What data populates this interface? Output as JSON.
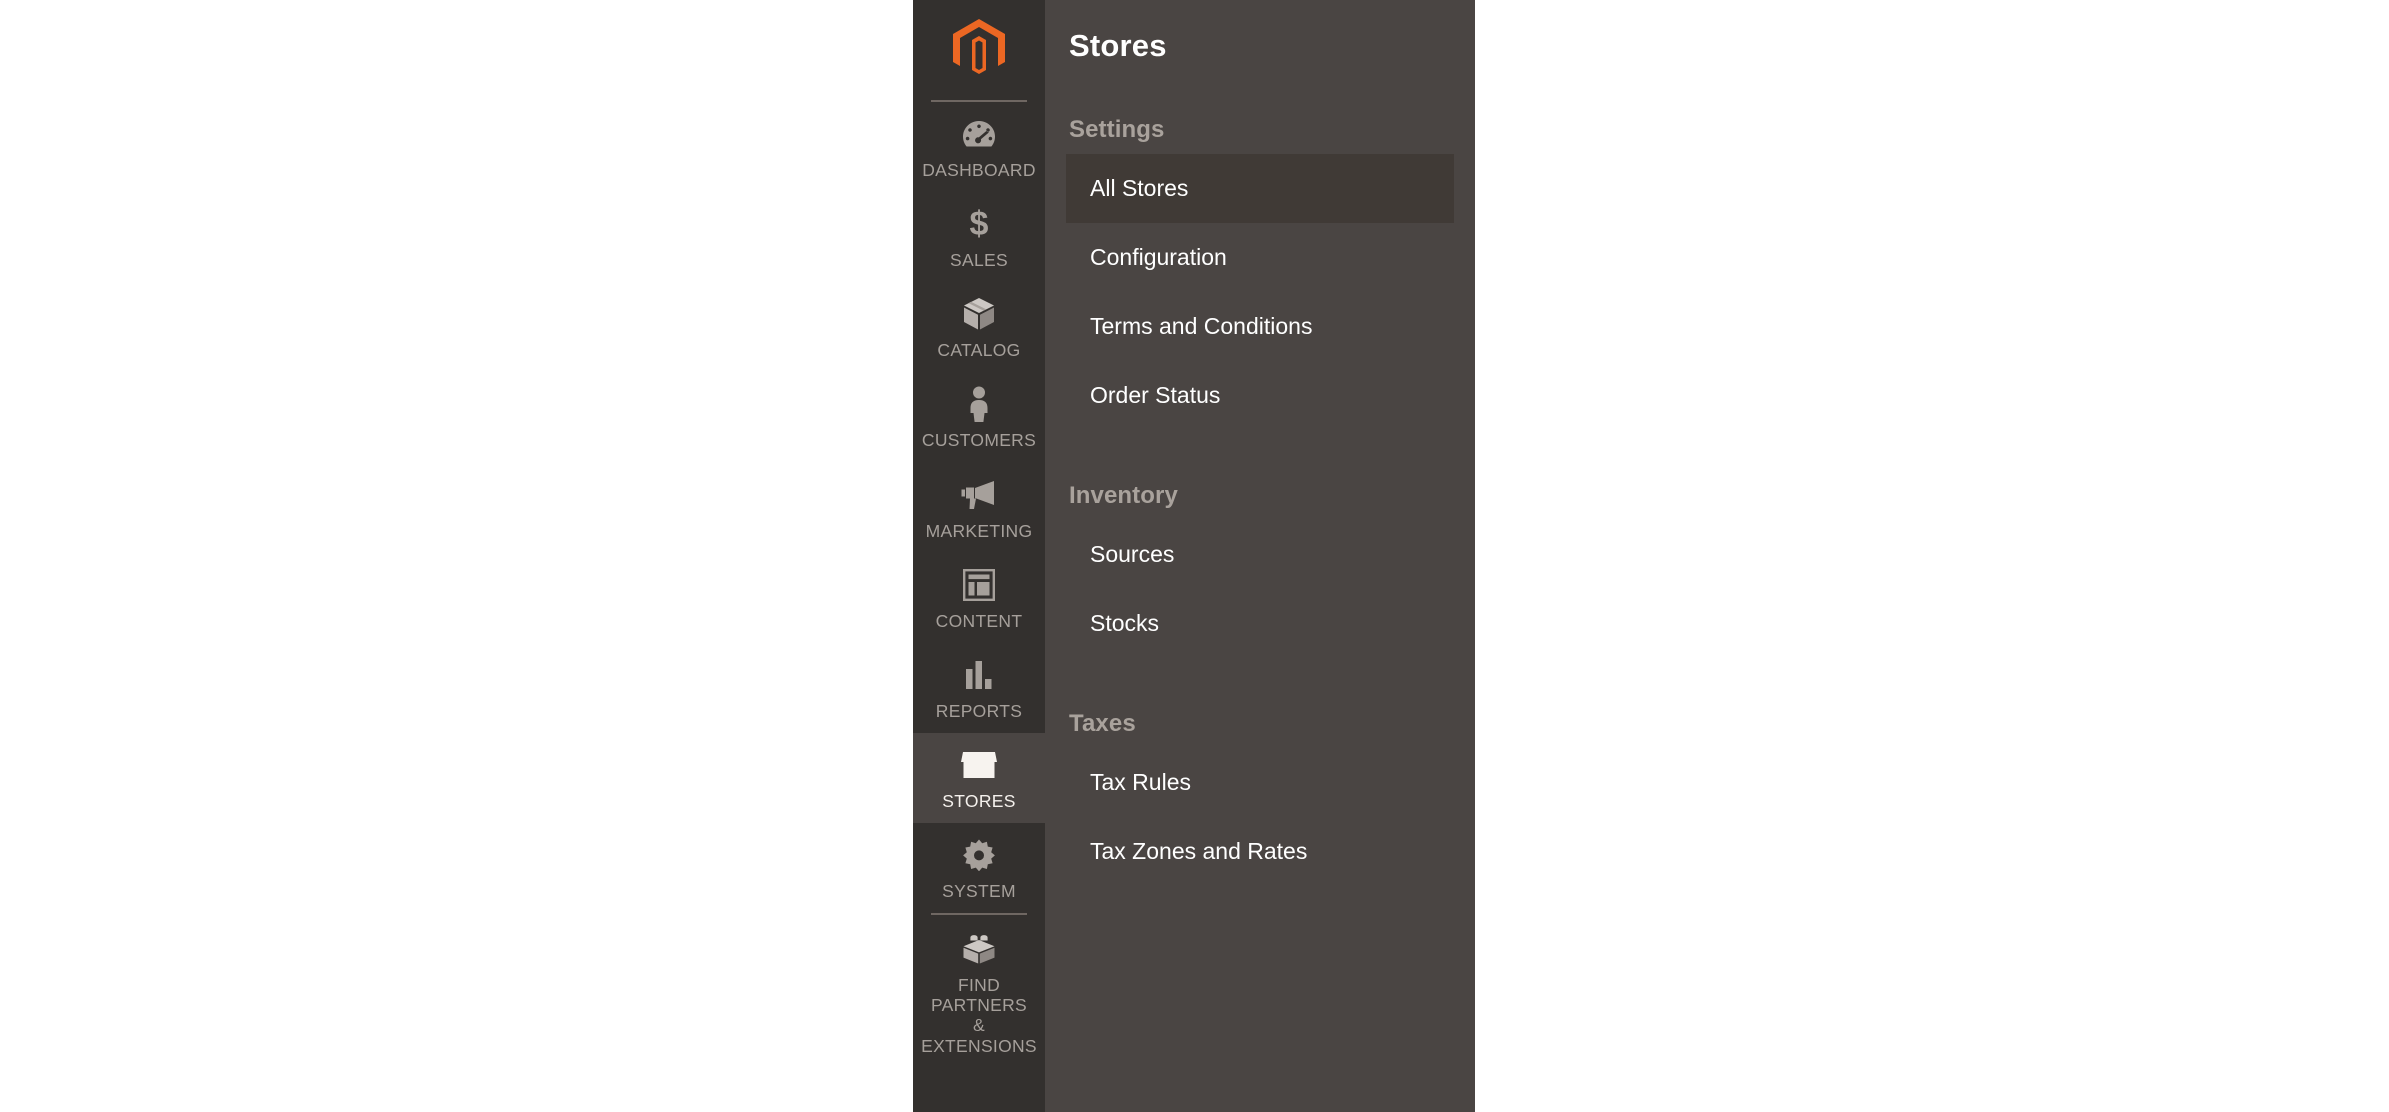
{
  "brand": {
    "logo_icon": "magento-logo-icon",
    "logo_color": "#ec6723"
  },
  "colors": {
    "rail_background": "#33302e",
    "submenu_background": "#4a4543",
    "active_item_background": "#403a36",
    "active_rail_background": "#4a4543",
    "label_text": "#a6a09b",
    "submenu_text": "#ffffff",
    "group_heading_text": "#a9a29c"
  },
  "rail": {
    "items": [
      {
        "label": "DASHBOARD",
        "icon": "gauge-icon",
        "active": false
      },
      {
        "label": "SALES",
        "icon": "dollar-icon",
        "active": false
      },
      {
        "label": "CATALOG",
        "icon": "box-icon",
        "active": false
      },
      {
        "label": "CUSTOMERS",
        "icon": "person-icon",
        "active": false
      },
      {
        "label": "MARKETING",
        "icon": "megaphone-icon",
        "active": false
      },
      {
        "label": "CONTENT",
        "icon": "layout-icon",
        "active": false
      },
      {
        "label": "REPORTS",
        "icon": "bar-chart-icon",
        "active": false
      },
      {
        "label": "STORES",
        "icon": "storefront-icon",
        "active": true
      },
      {
        "label": "SYSTEM",
        "icon": "gear-icon",
        "active": false
      },
      {
        "label": "FIND PARTNERS\n& EXTENSIONS",
        "icon": "lego-brick-icon",
        "active": false
      }
    ]
  },
  "submenu": {
    "title": "Stores",
    "groups": [
      {
        "heading": "Settings",
        "items": [
          {
            "label": "All Stores",
            "active": true
          },
          {
            "label": "Configuration",
            "active": false
          },
          {
            "label": "Terms and Conditions",
            "active": false
          },
          {
            "label": "Order Status",
            "active": false
          }
        ]
      },
      {
        "heading": "Inventory",
        "items": [
          {
            "label": "Sources",
            "active": false
          },
          {
            "label": "Stocks",
            "active": false
          }
        ]
      },
      {
        "heading": "Taxes",
        "items": [
          {
            "label": "Tax Rules",
            "active": false
          },
          {
            "label": "Tax Zones and Rates",
            "active": false
          }
        ]
      }
    ]
  }
}
